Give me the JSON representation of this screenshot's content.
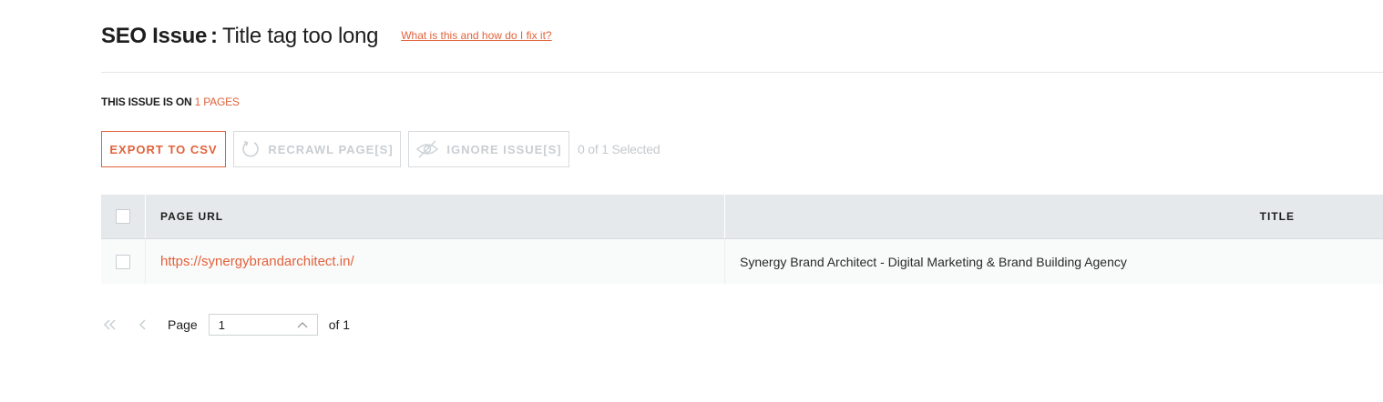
{
  "header": {
    "label": "SEO Issue",
    "separator": ":",
    "issue_name": "Title tag too long",
    "help_link": "What is this and how do I fix it?"
  },
  "summary": {
    "prefix": "THIS ISSUE IS ON",
    "count_text": "1 PAGES"
  },
  "toolbar": {
    "export_label": "EXPORT TO CSV",
    "recrawl_label": "RECRAWL PAGE[S]",
    "ignore_label": "IGNORE ISSUE[S]",
    "selected_text": "0 of 1 Selected"
  },
  "table": {
    "columns": [
      "PAGE URL",
      "TITLE"
    ],
    "rows": [
      {
        "url": "https://synergybrandarchitect.in/",
        "title": "Synergy Brand Architect - Digital Marketing & Brand Building Agency"
      }
    ]
  },
  "pagination": {
    "page_label": "Page",
    "current_page": "1",
    "of_text": "of 1"
  },
  "colors": {
    "accent": "#e2623b",
    "header_bg": "#e6e9eb",
    "disabled": "#c9ced2"
  }
}
